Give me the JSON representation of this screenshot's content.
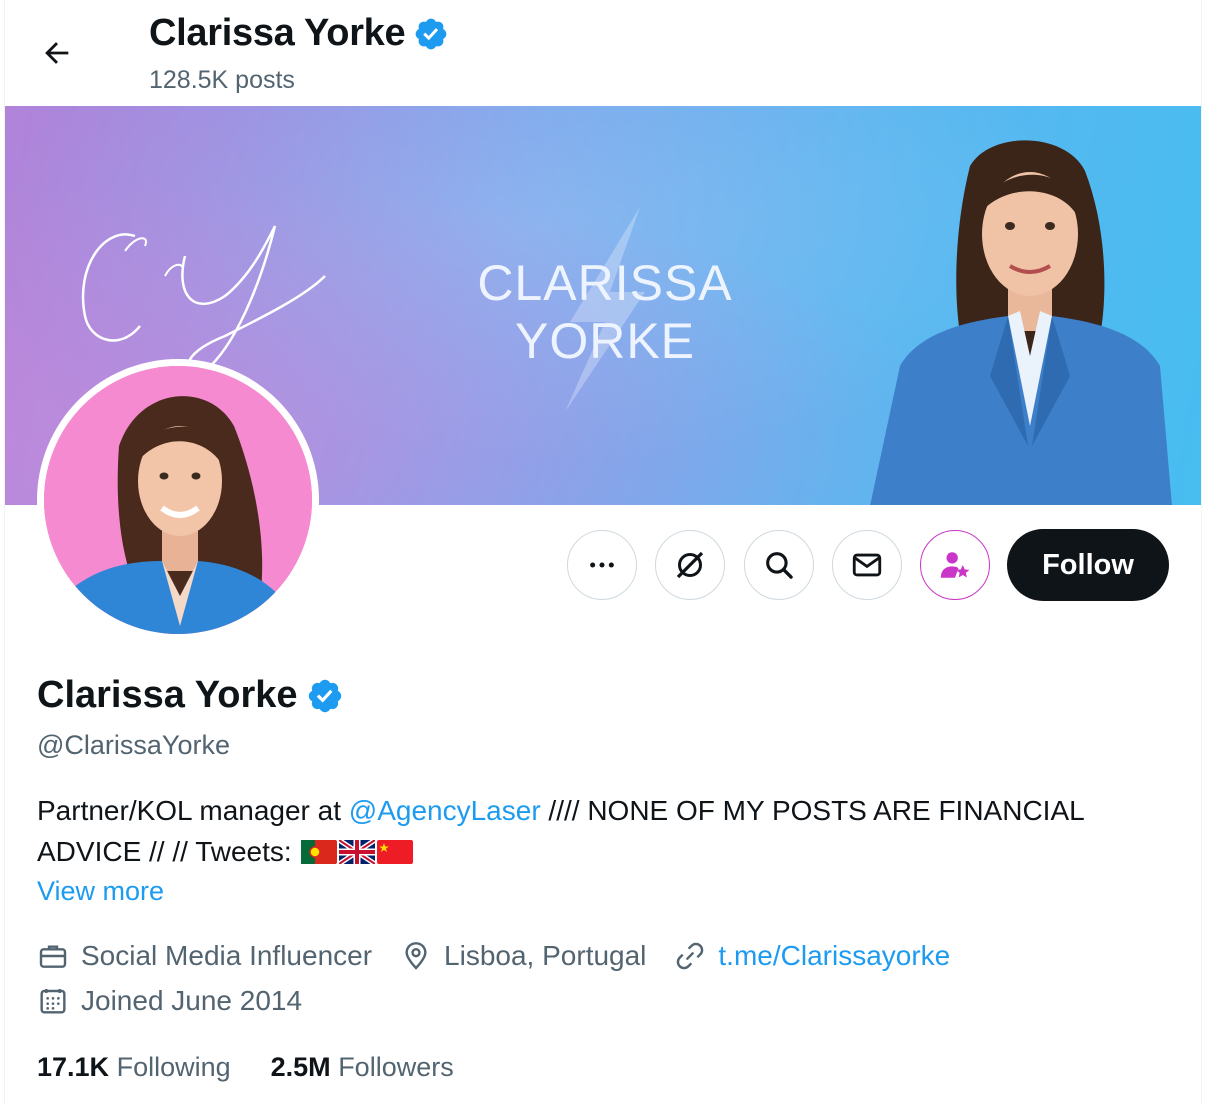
{
  "header": {
    "name": "Clarissa Yorke",
    "posts_count": "128.5K posts"
  },
  "banner": {
    "title_line1": "CLARISSA",
    "title_line2": "YORKE",
    "monogram": "CY"
  },
  "profile": {
    "display_name": "Clarissa Yorke",
    "handle": "@ClarissaYorke",
    "bio_prefix": "Partner/KOL manager at ",
    "bio_mention": "@AgencyLaser",
    "bio_suffix": " //// NONE OF MY POSTS ARE FINANCIAL ADVICE // // Tweets: ",
    "flags": [
      "portugal-flag",
      "uk-flag",
      "china-flag"
    ],
    "view_more": "View more",
    "category": "Social Media Influencer",
    "location": "Lisboa, Portugal",
    "link": "t.me/Clarissayorke",
    "joined": "Joined June 2014"
  },
  "stats": {
    "following_count": "17.1K",
    "following_label": "Following",
    "followers_count": "2.5M",
    "followers_label": "Followers"
  },
  "actions": {
    "follow_label": "Follow"
  },
  "icons": [
    "back-arrow-icon",
    "verified-badge-icon",
    "more-icon",
    "grok-icon",
    "search-icon",
    "mail-icon",
    "subscribe-icon",
    "briefcase-icon",
    "location-pin-icon",
    "link-icon",
    "calendar-icon"
  ],
  "colors": {
    "accent": "#1d9bf0",
    "follow_button": "#0f1419",
    "secondary_text": "#536471",
    "subscribe_accent": "#c936c8"
  }
}
